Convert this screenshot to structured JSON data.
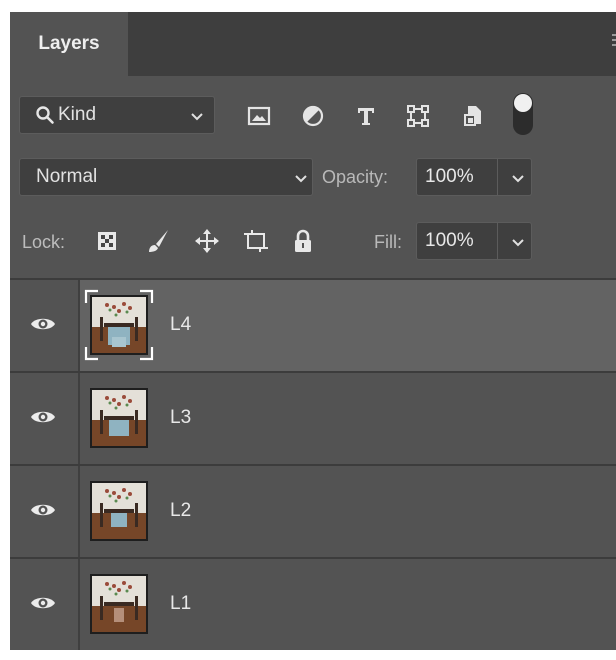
{
  "panel": {
    "tab_label": "Layers"
  },
  "filter": {
    "kind_label": "Kind",
    "icons": [
      "image-filter-icon",
      "adjustment-filter-icon",
      "type-filter-icon",
      "shape-filter-icon",
      "smart-object-filter-icon",
      "filter-toggle-switch"
    ]
  },
  "blend": {
    "mode": "Normal",
    "opacity_label": "Opacity:",
    "opacity_value": "100%"
  },
  "lock": {
    "label": "Lock:",
    "icons": [
      "lock-transparent-pixels-icon",
      "lock-image-pixels-icon",
      "lock-position-icon",
      "lock-artboard-icon",
      "lock-all-icon"
    ],
    "fill_label": "Fill:",
    "fill_value": "100%"
  },
  "layers": [
    {
      "name": "L4",
      "selected": true,
      "visible": true
    },
    {
      "name": "L3",
      "selected": false,
      "visible": true
    },
    {
      "name": "L2",
      "selected": false,
      "visible": true
    },
    {
      "name": "L1",
      "selected": false,
      "visible": true
    }
  ],
  "colors": {
    "panel_bg": "#535353",
    "tabbar_bg": "#3e3e3e",
    "selected_row": "#636363",
    "field_bg": "#3f3f3f"
  }
}
